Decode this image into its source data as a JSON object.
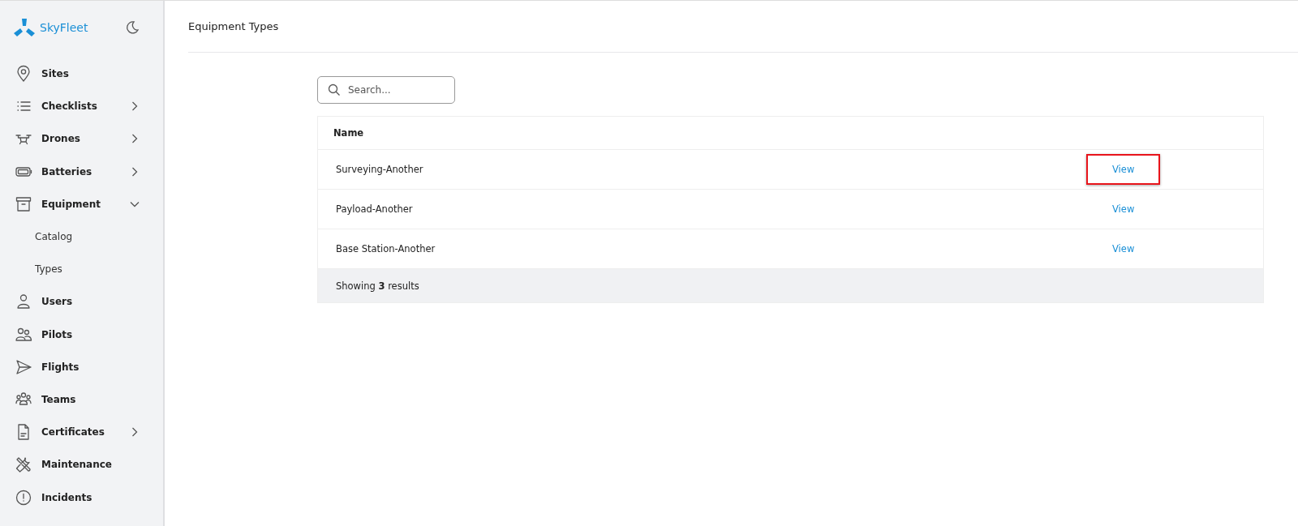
{
  "brand": {
    "name": "SkyFleet"
  },
  "sidebar": {
    "items": [
      {
        "label": "Sites"
      },
      {
        "label": "Checklists",
        "expanded": false
      },
      {
        "label": "Drones",
        "expanded": false
      },
      {
        "label": "Batteries",
        "expanded": false
      },
      {
        "label": "Equipment",
        "expanded": true,
        "children": [
          {
            "label": "Catalog"
          },
          {
            "label": "Types"
          }
        ]
      },
      {
        "label": "Users"
      },
      {
        "label": "Pilots"
      },
      {
        "label": "Flights"
      },
      {
        "label": "Teams"
      },
      {
        "label": "Certificates",
        "expanded": false
      },
      {
        "label": "Maintenance"
      },
      {
        "label": "Incidents"
      }
    ]
  },
  "page": {
    "title": "Equipment Types"
  },
  "search": {
    "placeholder": "Search..."
  },
  "table": {
    "columns": [
      "Name"
    ],
    "rows": [
      {
        "name": "Surveying-Another",
        "action": "View",
        "highlighted": true
      },
      {
        "name": "Payload-Another",
        "action": "View",
        "highlighted": false
      },
      {
        "name": "Base Station-Another",
        "action": "View",
        "highlighted": false
      }
    ],
    "footer": "Showing **3** results"
  }
}
